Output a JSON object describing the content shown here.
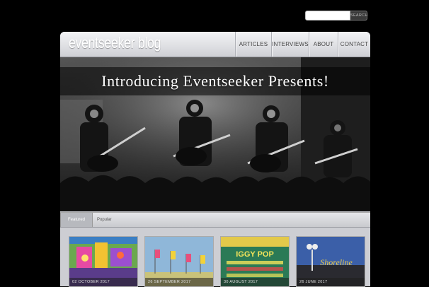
{
  "search": {
    "placeholder": "",
    "button_label": "SEARCH"
  },
  "header": {
    "logo_text": "eventseeker blog"
  },
  "nav": [
    {
      "label": "ARTICLES"
    },
    {
      "label": "INTERVIEWS"
    },
    {
      "label": "ABOUT"
    },
    {
      "label": "CONTACT"
    }
  ],
  "hero": {
    "title": "Introducing Eventseeker Presents!",
    "slide_count": 4,
    "active_slide": 4
  },
  "tabs": [
    {
      "label": "Featured",
      "active": true
    },
    {
      "label": "Popular",
      "active": false
    }
  ],
  "posts": [
    {
      "date": "02 OCTOBER 2017"
    },
    {
      "date": "26 SEPTEMBER 2017"
    },
    {
      "date": "30 AUGUST 2017"
    },
    {
      "date": "26 JUNE 2017"
    }
  ],
  "thumb_texts": {
    "poster_headline": "IGGY POP",
    "sign_text": "Shoreline"
  },
  "colors": {
    "background": "#000000",
    "panel": "#cdced3",
    "banner": "rgba(0,0,0,0.55)"
  }
}
